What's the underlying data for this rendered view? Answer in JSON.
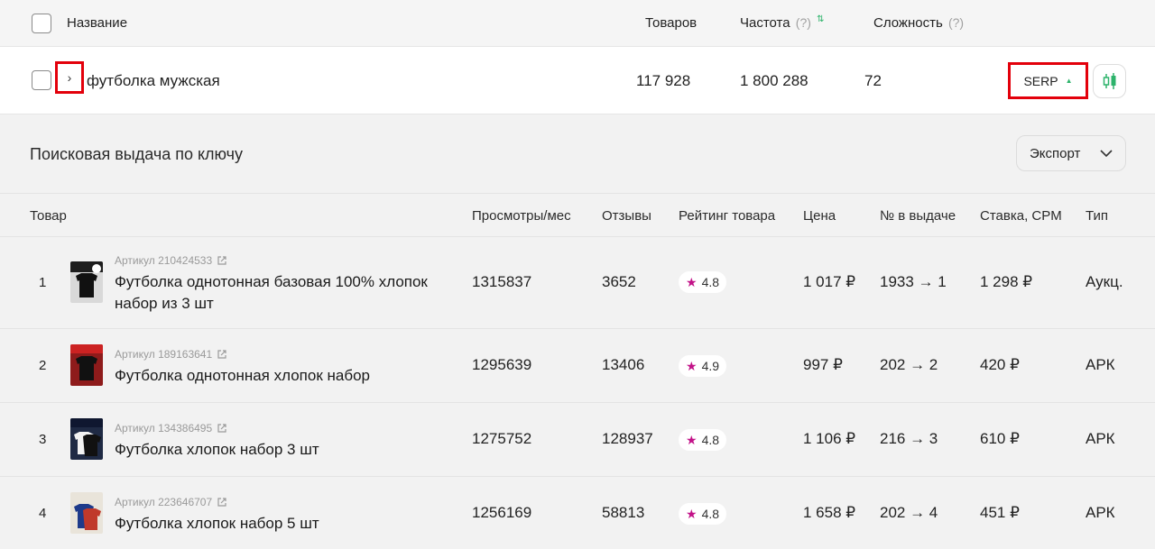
{
  "header": {
    "name": "Название",
    "products": "Товаров",
    "frequency": "Частота",
    "frequency_hint": "(?)",
    "difficulty": "Сложность",
    "difficulty_hint": "(?)"
  },
  "keyword": {
    "expand_glyph": "›",
    "text": "футболка мужская",
    "products": "117 928",
    "frequency": "1 800 288",
    "difficulty": "72",
    "serp_label": "SERP"
  },
  "serp": {
    "title": "Поисковая выдача по ключу",
    "export_label": "Экспорт",
    "columns": {
      "product": "Товар",
      "views": "Просмотры/мес",
      "reviews": "Отзывы",
      "rating": "Рейтинг товара",
      "price": "Цена",
      "position": "№ в выдаче",
      "bid": "Ставка, CPM",
      "type": "Тип"
    },
    "rows": [
      {
        "n": "1",
        "sku": "Артикул 210424533",
        "name": "Футболка однотонная базовая 100% хлопок набор из 3 шт",
        "views": "1315837",
        "reviews": "3652",
        "rating": "4.8",
        "price": "1 017 ₽",
        "position": "1933 → 1",
        "bid": "1 298 ₽",
        "type": "Аукц."
      },
      {
        "n": "2",
        "sku": "Артикул 189163641",
        "name": "Футболка однотонная хлопок набор",
        "views": "1295639",
        "reviews": "13406",
        "rating": "4.9",
        "price": "997 ₽",
        "position": "202 → 2",
        "bid": "420 ₽",
        "type": "АРК"
      },
      {
        "n": "3",
        "sku": "Артикул 134386495",
        "name": "Футболка хлопок набор 3 шт",
        "views": "1275752",
        "reviews": "128937",
        "rating": "4.8",
        "price": "1 106 ₽",
        "position": "216 → 3",
        "bid": "610 ₽",
        "type": "АРК"
      },
      {
        "n": "4",
        "sku": "Артикул 223646707",
        "name": "Футболка хлопок набор 5 шт",
        "views": "1256169",
        "reviews": "58813",
        "rating": "4.8",
        "price": "1 658 ₽",
        "position": "202 → 4",
        "bid": "451 ₽",
        "type": "АРК"
      }
    ]
  },
  "colors": {
    "highlight": "#e3000b",
    "accent_green": "#2db36b",
    "star": "#c21288"
  }
}
